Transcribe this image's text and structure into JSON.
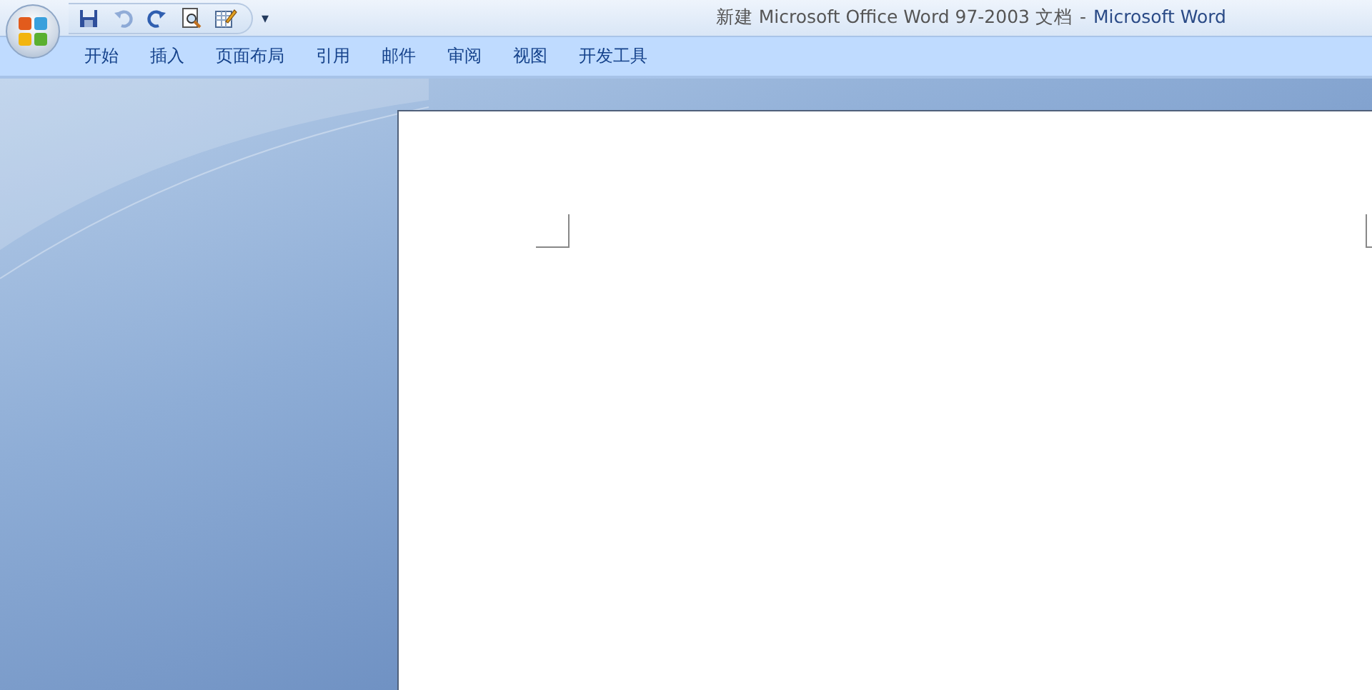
{
  "window": {
    "document_title": "新建 Microsoft Office Word 97-2003 文档",
    "separator": "-",
    "app_name": "Microsoft Word"
  },
  "quick_access": [
    {
      "kind": "save",
      "disabled": false
    },
    {
      "kind": "undo",
      "disabled": true
    },
    {
      "kind": "redo",
      "disabled": false
    },
    {
      "kind": "preview",
      "disabled": false
    },
    {
      "kind": "edit",
      "disabled": false
    }
  ],
  "customize_glyph": "▾",
  "tabs": [
    {
      "label": "开始"
    },
    {
      "label": "插入"
    },
    {
      "label": "页面布局"
    },
    {
      "label": "引用"
    },
    {
      "label": "邮件"
    },
    {
      "label": "审阅"
    },
    {
      "label": "视图"
    },
    {
      "label": "开发工具"
    }
  ]
}
